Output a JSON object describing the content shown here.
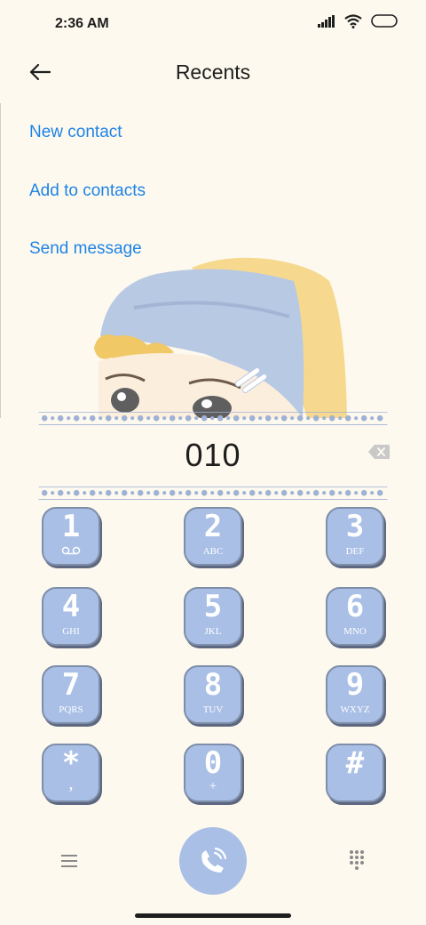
{
  "status": {
    "time": "2:36 AM"
  },
  "header": {
    "title": "Recents"
  },
  "options": [
    {
      "label": "New contact"
    },
    {
      "label": "Add to contacts"
    },
    {
      "label": "Send message"
    }
  ],
  "dialer": {
    "number": "010"
  },
  "keys": [
    {
      "digit": "1",
      "letters": ""
    },
    {
      "digit": "2",
      "letters": "ABC"
    },
    {
      "digit": "3",
      "letters": "DEF"
    },
    {
      "digit": "4",
      "letters": "GHI"
    },
    {
      "digit": "5",
      "letters": "JKL"
    },
    {
      "digit": "6",
      "letters": "MNO"
    },
    {
      "digit": "7",
      "letters": "PQRS"
    },
    {
      "digit": "8",
      "letters": "TUV"
    },
    {
      "digit": "9",
      "letters": "WXYZ"
    },
    {
      "digit": "*",
      "letters": ","
    },
    {
      "digit": "0",
      "letters": "+"
    },
    {
      "digit": "#",
      "letters": ""
    }
  ],
  "icons": {
    "back": "arrow-left-icon",
    "backspace": "backspace-icon",
    "menu": "menu-icon",
    "call": "phone-call-icon",
    "dialpad": "dialpad-icon",
    "voicemail": "voicemail-icon"
  },
  "colors": {
    "background": "#fdf9ee",
    "link": "#1f84e6",
    "key": "#a9bfe6"
  }
}
